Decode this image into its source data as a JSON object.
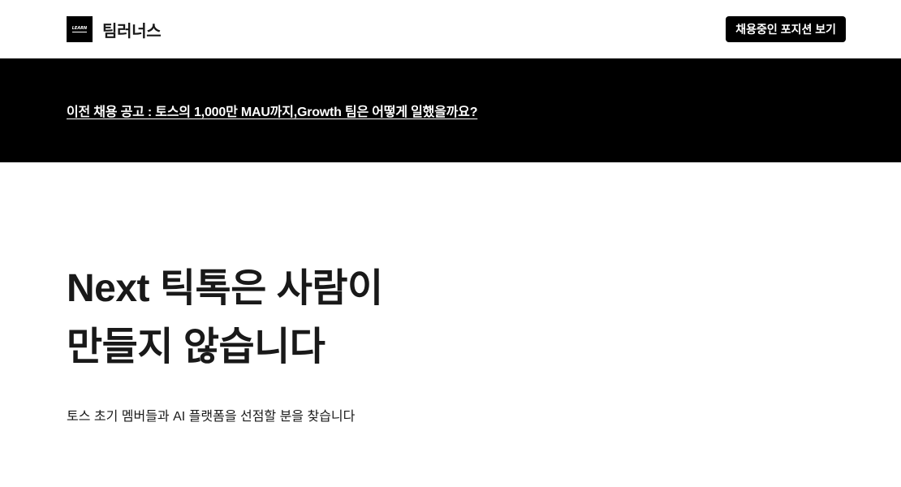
{
  "header": {
    "logo_text": "LEARN",
    "brand_name": "팀러너스",
    "cta_label": "채용중인 포지션 보기"
  },
  "banner": {
    "link_text": "이전 채용 공고 : 토스의 1,000만 MAU까지,Growth 팀은 어떻게 일했을까요?"
  },
  "hero": {
    "title_line1": "Next 틱톡은 사람이",
    "title_line2": "만들지 않습니다",
    "subtitle": "토스 초기 멤버들과 AI 플랫폼을 선점할 분을 찾습니다"
  },
  "colors": {
    "primary": "#000000",
    "background": "#ffffff",
    "text": "#191919",
    "banner_text": "#ffffff"
  }
}
